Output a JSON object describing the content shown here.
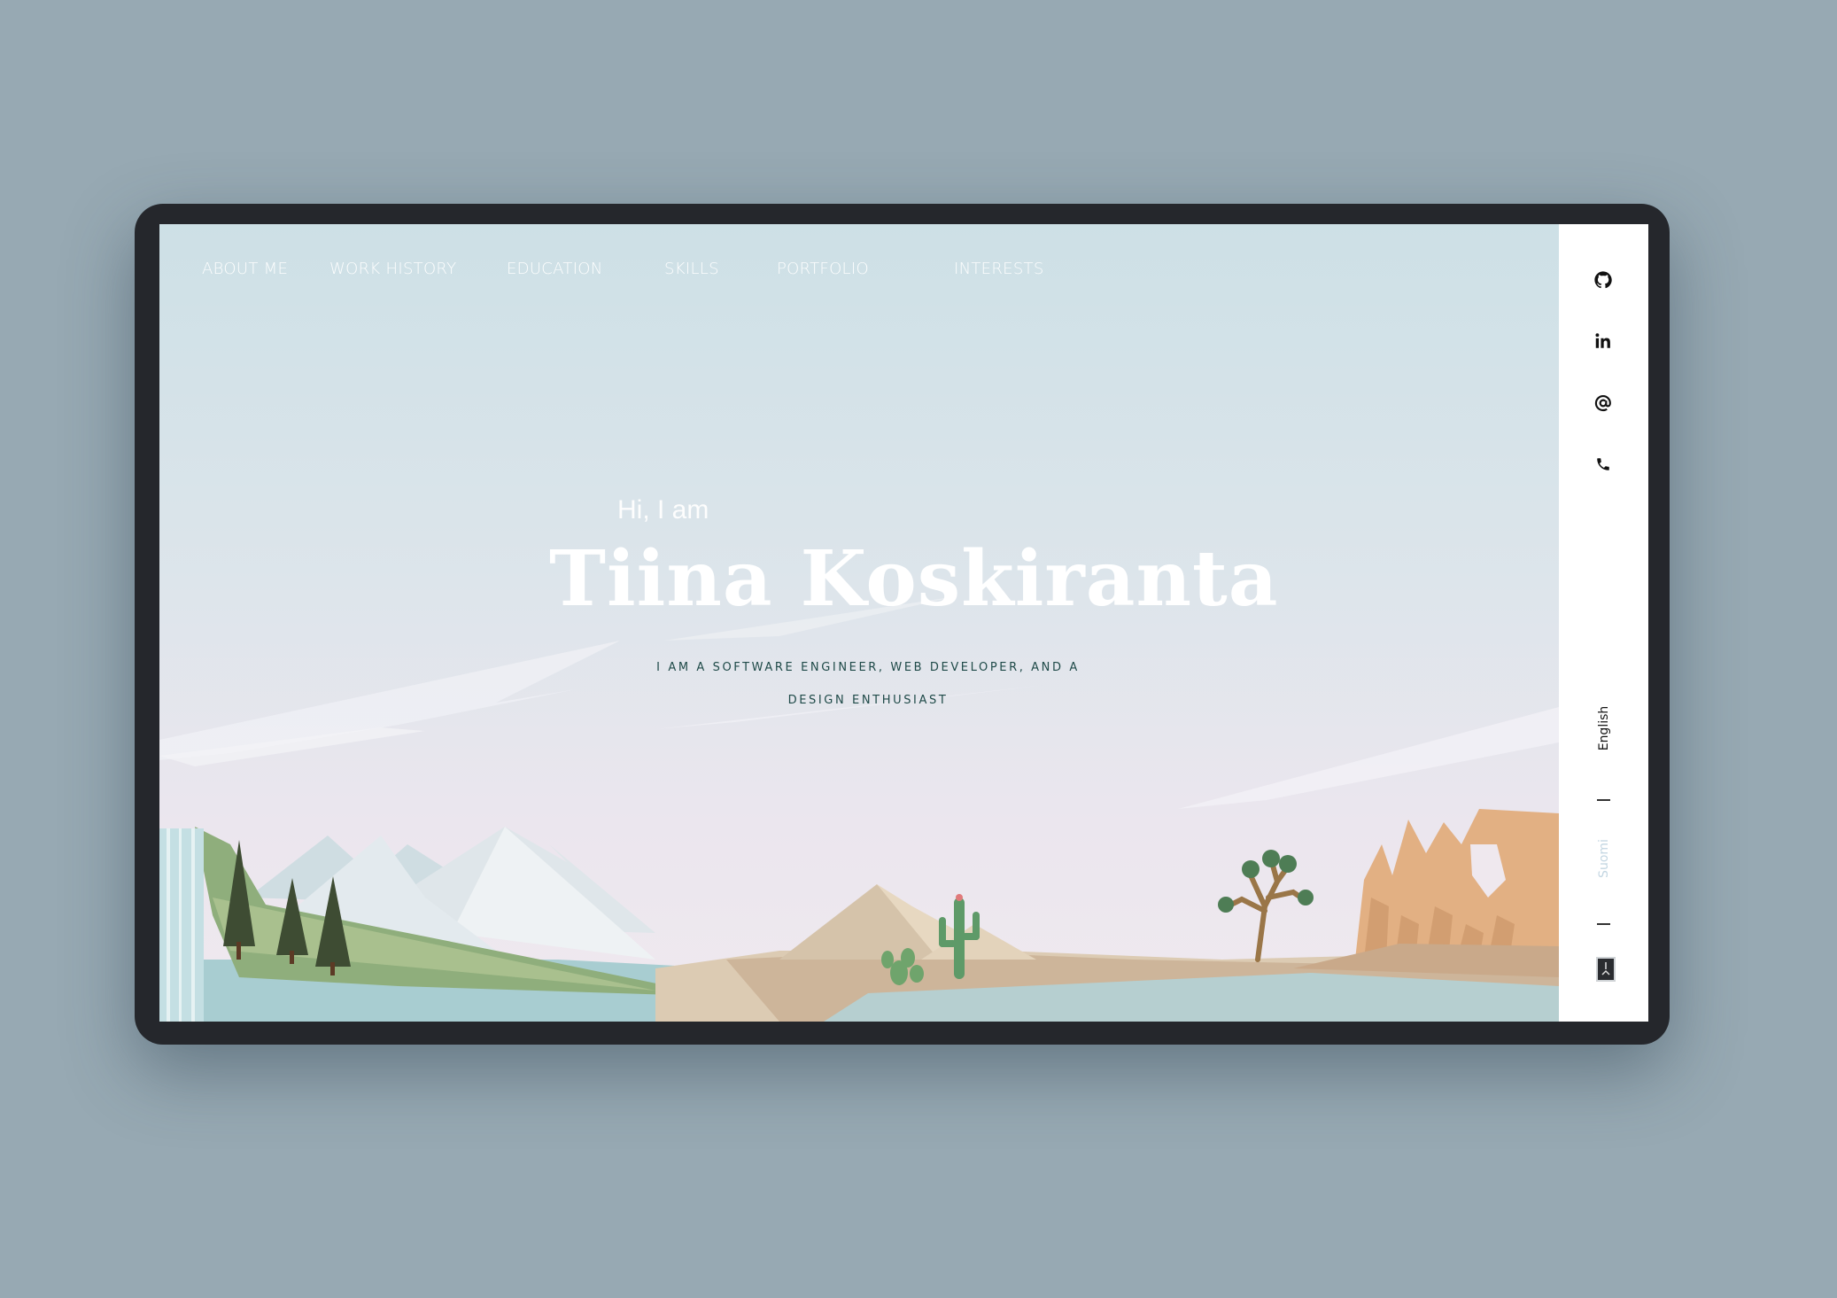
{
  "nav": {
    "items": [
      {
        "label": "ABOUT ME"
      },
      {
        "label": "WORK HISTORY"
      },
      {
        "label": "EDUCATION"
      },
      {
        "label": "SKILLS"
      },
      {
        "label": "PORTFOLIO"
      },
      {
        "label": "INTERESTS"
      }
    ]
  },
  "hero": {
    "greeting": "Hi, I am",
    "name": "Tiina Koskiranta",
    "tagline": "I AM A SOFTWARE ENGINEER, WEB DEVELOPER, AND A DESIGN ENTHUSIAST"
  },
  "sidebar": {
    "icons": [
      "github-icon",
      "linkedin-icon",
      "email-icon",
      "phone-icon"
    ],
    "languages": [
      {
        "label": "English",
        "active": true
      },
      {
        "label": "Suomi",
        "active": false
      }
    ]
  },
  "colors": {
    "background": "#97a9b3",
    "device": "#25272c",
    "sky_top": "#cde0e6",
    "sky_bottom": "#efe9ef",
    "tagline": "#1f4a48",
    "inactive_lang": "#c3d6e2"
  }
}
